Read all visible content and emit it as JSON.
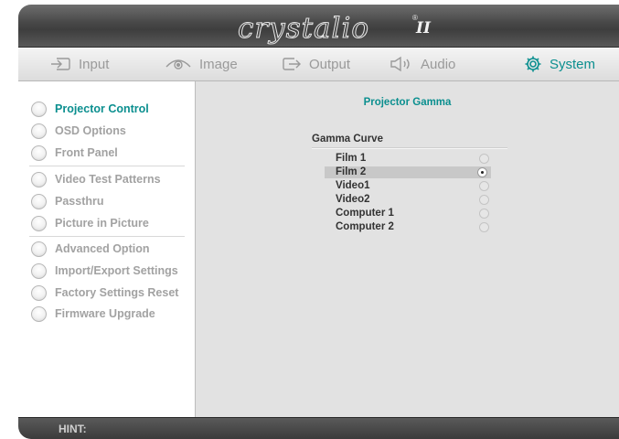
{
  "app": {
    "logo_text": "crystalio",
    "logo_mark": "II",
    "logo_reg": "®"
  },
  "tabs": [
    {
      "label": "Input",
      "icon": "input-icon"
    },
    {
      "label": "Image",
      "icon": "eye-icon"
    },
    {
      "label": "Output",
      "icon": "output-icon"
    },
    {
      "label": "Audio",
      "icon": "speaker-icon"
    },
    {
      "label": "System",
      "icon": "gear-icon",
      "active": true
    }
  ],
  "sidebar": {
    "items": [
      {
        "label": "Projector Control",
        "active": true
      },
      {
        "label": "OSD Options"
      },
      {
        "label": "Front Panel"
      },
      {
        "label": "Video Test Patterns"
      },
      {
        "label": "Passthru"
      },
      {
        "label": "Picture in Picture"
      },
      {
        "label": "Advanced Option"
      },
      {
        "label": "Import/Export Settings"
      },
      {
        "label": "Factory Settings Reset"
      },
      {
        "label": "Firmware Upgrade"
      }
    ]
  },
  "main": {
    "panel_title": "Projector Gamma",
    "group_title": "Gamma Curve",
    "options": [
      {
        "label": "Film 1",
        "selected": false
      },
      {
        "label": "Film 2",
        "selected": true
      },
      {
        "label": "Video1",
        "selected": false
      },
      {
        "label": "Video2",
        "selected": false
      },
      {
        "label": "Computer 1",
        "selected": false
      },
      {
        "label": "Computer 2",
        "selected": false
      }
    ]
  },
  "hint": {
    "label": "HINT:"
  },
  "colors": {
    "accent": "#0b8f8f",
    "title_bar": "#4a4a4a",
    "sidebar_bg": "#ffffff",
    "content_bg": "#e2e2e2"
  }
}
